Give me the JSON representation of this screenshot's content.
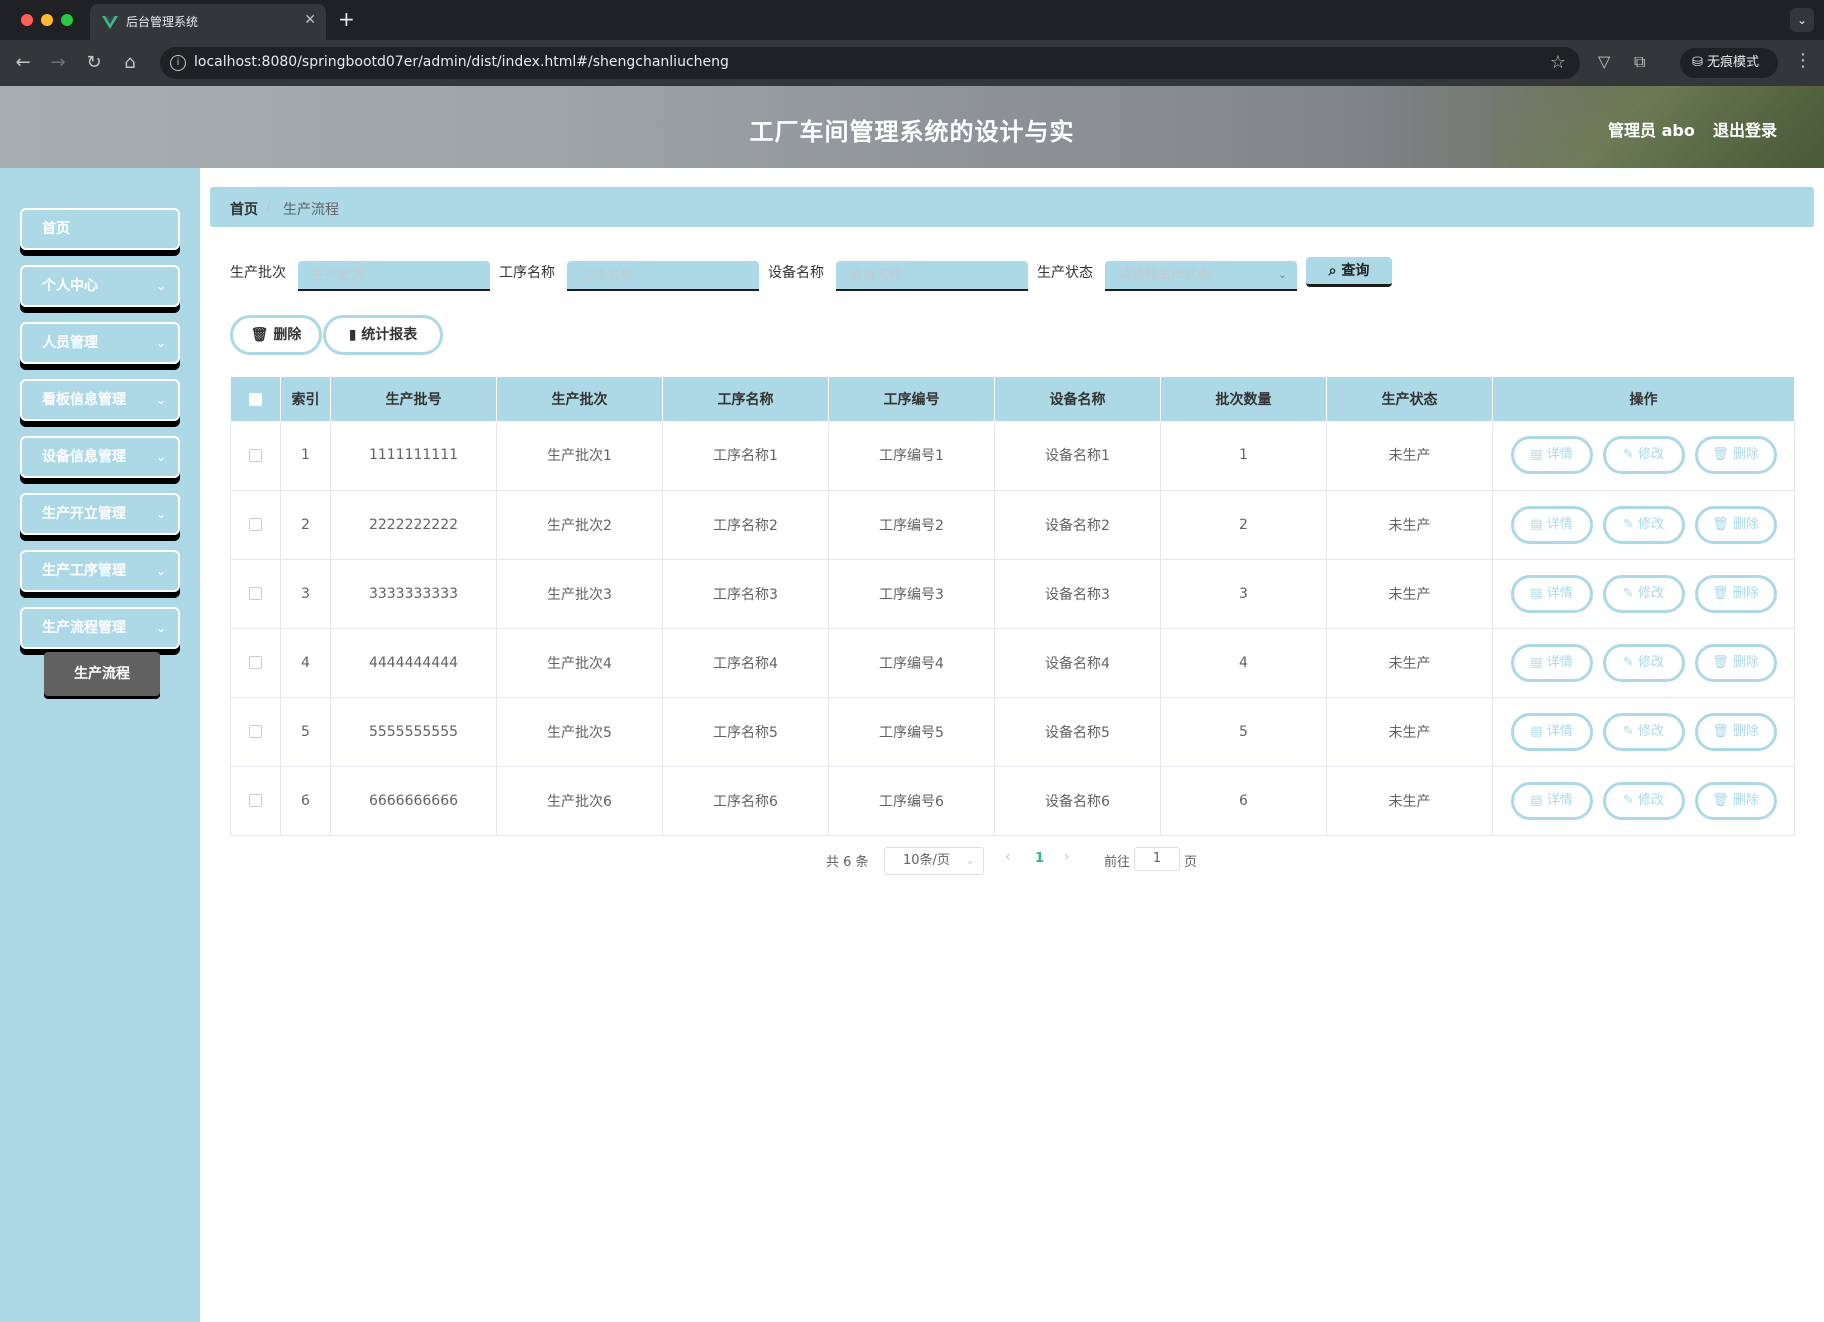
{
  "browser": {
    "tab_title": "后台管理系统",
    "url": "localhost:8080/springbootd07er/admin/dist/index.html#/shengchanliucheng",
    "incognito_label": "无痕模式"
  },
  "header": {
    "title": "工厂车间管理系统的设计与实",
    "user_label": "管理员 abo",
    "logout_label": "退出登录"
  },
  "sidebar": {
    "items": [
      {
        "label": "首页"
      },
      {
        "label": "个人中心"
      },
      {
        "label": "人员管理"
      },
      {
        "label": "看板信息管理"
      },
      {
        "label": "设备信息管理"
      },
      {
        "label": "生产开立管理"
      },
      {
        "label": "生产工序管理"
      },
      {
        "label": "生产流程管理"
      }
    ],
    "active_sub": "生产流程"
  },
  "breadcrumb": {
    "home": "首页",
    "separator": "/",
    "current": "生产流程"
  },
  "filters": [
    {
      "label": "生产批次",
      "placeholder": "生产批次"
    },
    {
      "label": "工序名称",
      "placeholder": "工序名称"
    },
    {
      "label": "设备名称",
      "placeholder": "设备名称"
    },
    {
      "label": "生产状态",
      "placeholder": "请选择生产状态"
    }
  ],
  "search_label": "查询",
  "actions": {
    "delete_label": "删除",
    "report_label": "统计报表"
  },
  "table": {
    "headers": [
      "",
      "索引",
      "生产批号",
      "生产批次",
      "工序名称",
      "工序编号",
      "设备名称",
      "批次数量",
      "生产状态",
      "操作"
    ],
    "rows": [
      {
        "index": "1",
        "batch_no": "1111111111",
        "batch": "生产批次1",
        "process_name": "工序名称1",
        "process_no": "工序编号1",
        "device": "设备名称1",
        "qty": "1",
        "status": "未生产"
      },
      {
        "index": "2",
        "batch_no": "2222222222",
        "batch": "生产批次2",
        "process_name": "工序名称2",
        "process_no": "工序编号2",
        "device": "设备名称2",
        "qty": "2",
        "status": "未生产"
      },
      {
        "index": "3",
        "batch_no": "3333333333",
        "batch": "生产批次3",
        "process_name": "工序名称3",
        "process_no": "工序编号3",
        "device": "设备名称3",
        "qty": "3",
        "status": "未生产"
      },
      {
        "index": "4",
        "batch_no": "4444444444",
        "batch": "生产批次4",
        "process_name": "工序名称4",
        "process_no": "工序编号4",
        "device": "设备名称4",
        "qty": "4",
        "status": "未生产"
      },
      {
        "index": "5",
        "batch_no": "5555555555",
        "batch": "生产批次5",
        "process_name": "工序名称5",
        "process_no": "工序编号5",
        "device": "设备名称5",
        "qty": "5",
        "status": "未生产"
      },
      {
        "index": "6",
        "batch_no": "6666666666",
        "batch": "生产批次6",
        "process_name": "工序名称6",
        "process_no": "工序编号6",
        "device": "设备名称6",
        "qty": "6",
        "status": "未生产"
      }
    ],
    "op_labels": {
      "detail": "详情",
      "edit": "修改",
      "delete": "删除"
    }
  },
  "pagination": {
    "total_label": "共 6 条",
    "page_size": "10条/页",
    "current_page": "1",
    "goto_label": "前往",
    "goto_value": "1",
    "page_unit": "页"
  },
  "colors": {
    "theme": "#add8e6",
    "submenu_active": "#616161",
    "page_active": "#2fb58a"
  }
}
